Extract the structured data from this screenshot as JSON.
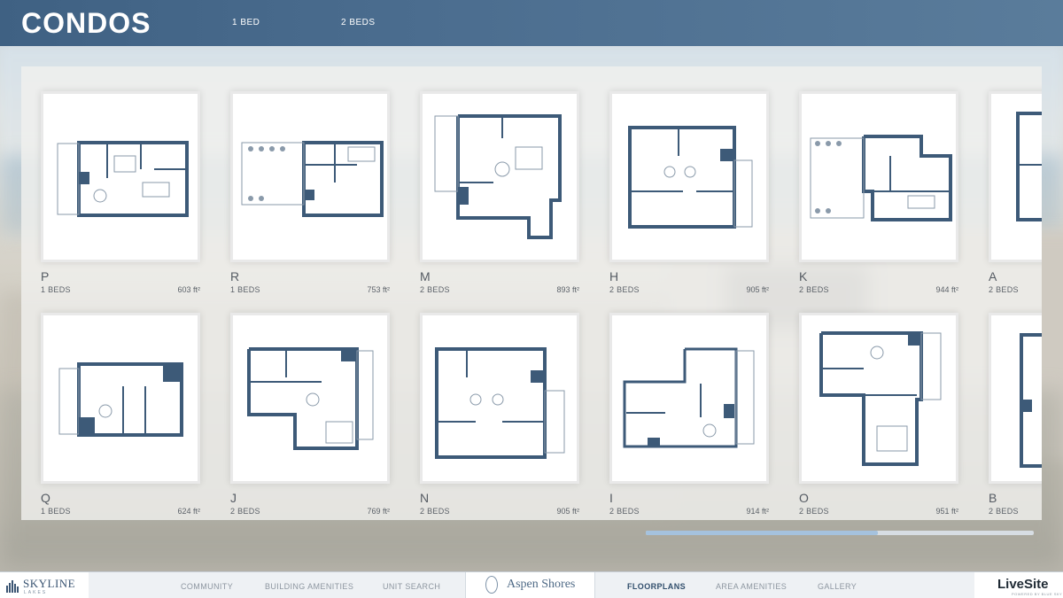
{
  "header": {
    "title": "CONDOS",
    "filters": [
      "1 BED",
      "2 BEDS"
    ]
  },
  "units_row1": [
    {
      "name": "P",
      "beds": "1 BEDS",
      "area": "603 ft²"
    },
    {
      "name": "R",
      "beds": "1 BEDS",
      "area": "753 ft²"
    },
    {
      "name": "M",
      "beds": "2 BEDS",
      "area": "893 ft²"
    },
    {
      "name": "H",
      "beds": "2 BEDS",
      "area": "905 ft²"
    },
    {
      "name": "K",
      "beds": "2 BEDS",
      "area": "944 ft²"
    },
    {
      "name": "A",
      "beds": "2 BEDS",
      "area": ""
    }
  ],
  "units_row2": [
    {
      "name": "Q",
      "beds": "1 BEDS",
      "area": "624 ft²"
    },
    {
      "name": "J",
      "beds": "2 BEDS",
      "area": "769 ft²"
    },
    {
      "name": "N",
      "beds": "2 BEDS",
      "area": "905 ft²"
    },
    {
      "name": "I",
      "beds": "2 BEDS",
      "area": "914 ft²"
    },
    {
      "name": "O",
      "beds": "2 BEDS",
      "area": "951 ft²"
    },
    {
      "name": "B",
      "beds": "2 BEDS",
      "area": ""
    }
  ],
  "scroll": {
    "position_fraction": 0.6
  },
  "footer": {
    "left_brand": "SKYLINE",
    "left_brand_sub": "LAKES",
    "nav_left": [
      "COMMUNITY",
      "BUILDING AMENITIES",
      "UNIT SEARCH"
    ],
    "center_brand": "Aspen Shores",
    "nav_right": [
      "FLOORPLANS",
      "AREA AMENITIES",
      "GALLERY"
    ],
    "active_nav": "FLOORPLANS",
    "right_brand": "LiveSite",
    "right_brand_sub": "POWERED BY BLUE SKY"
  },
  "colors": {
    "header": "#4b6d8f",
    "plan_wall": "#3d5a78",
    "active_nav": "#314e6c",
    "scroll_thumb": "#a5c2de"
  }
}
